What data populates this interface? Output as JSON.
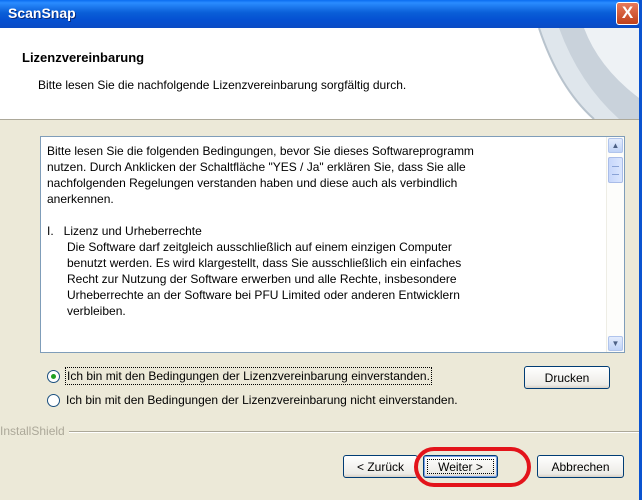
{
  "window": {
    "title": "ScanSnap",
    "close_glyph": "X"
  },
  "header": {
    "title": "Lizenzvereinbarung",
    "subtitle": "Bitte lesen Sie die nachfolgende Lizenzvereinbarung sorgfältig durch."
  },
  "license": {
    "intro_lines": [
      "Bitte lesen Sie die folgenden Bedingungen, bevor Sie dieses Softwareprogramm",
      "nutzen. Durch Anklicken der Schaltfläche \"YES / Ja\" erklären Sie, dass Sie alle",
      "nachfolgenden Regelungen verstanden haben und diese auch als verbindlich",
      "anerkennen."
    ],
    "section_title": "I.   Lizenz und Urheberrechte",
    "section_lines": [
      "Die Software darf zeitgleich ausschließlich auf einem einzigen Computer",
      "benutzt werden. Es wird klargestellt, dass Sie ausschließlich ein einfaches",
      "Recht zur Nutzung der Software erwerben und alle Rechte, insbesondere",
      "Urheberrechte an der Software bei PFU Limited oder anderen Entwicklern",
      "verbleiben."
    ]
  },
  "options": {
    "accept_label": "Ich bin mit den Bedingungen der Lizenzvereinbarung einverstanden.",
    "decline_label": "Ich bin mit den Bedingungen der Lizenzvereinbarung nicht einverstanden.",
    "selected": "accept"
  },
  "buttons": {
    "print": "Drucken",
    "back": "< Zurück",
    "next": "Weiter >",
    "cancel": "Abbrechen"
  },
  "footer": {
    "brand": "InstallShield"
  },
  "colors": {
    "highlight": "#e3141b",
    "titlebar": "#0551d2",
    "accent_radio": "#21a121"
  }
}
